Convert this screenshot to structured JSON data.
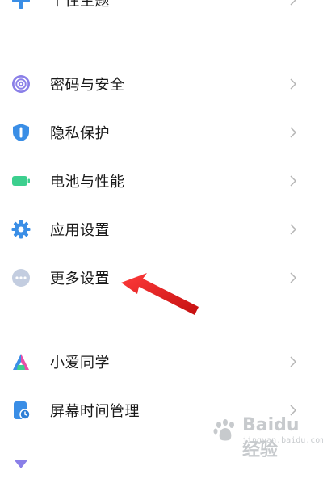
{
  "colors": {
    "purple": "#8a7fe8",
    "blue": "#3a8ee6",
    "green": "#3ccf8e",
    "gray": "#8fa3c6",
    "arrow": "#e81f1f"
  },
  "items": [
    {
      "label": "个性主题",
      "icon": "plus-icon"
    },
    {
      "label": "密码与安全",
      "icon": "fingerprint-icon"
    },
    {
      "label": "隐私保护",
      "icon": "shield-icon"
    },
    {
      "label": "电池与性能",
      "icon": "battery-icon"
    },
    {
      "label": "应用设置",
      "icon": "gear-icon"
    },
    {
      "label": "更多设置",
      "icon": "more-dots-icon"
    },
    {
      "label": "小爱同学",
      "icon": "xiaoai-icon"
    },
    {
      "label": "屏幕时间管理",
      "icon": "screen-time-icon"
    },
    {
      "label": "",
      "icon": "partial-icon"
    }
  ],
  "watermark": {
    "text": "Baidu经验",
    "sub": "jingyan.baidu.com"
  }
}
